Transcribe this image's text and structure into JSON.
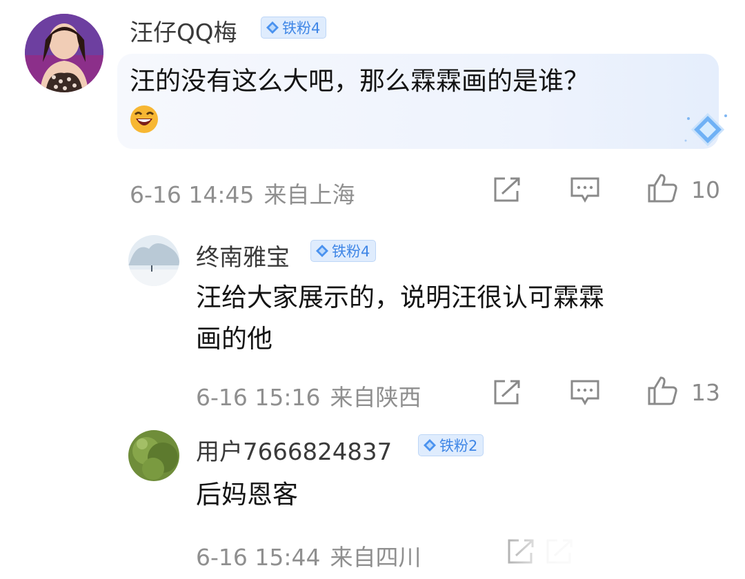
{
  "comments": [
    {
      "username": "汪仔QQ梅",
      "badge": "铁粉4",
      "text": "汪的没有这么大吧，那么霖霖画的是谁？",
      "emoji": "laughing-emoji",
      "date": "6-16 14:45",
      "location": "来自上海",
      "likes": "10"
    },
    {
      "username": "终南雅宝",
      "badge": "铁粉4",
      "text_line1": "汪给大家展示的，说明汪很认可霖霖",
      "text_line2": "画的他",
      "date": "6-16 15:16",
      "location": "来自陕西",
      "likes": "13"
    },
    {
      "username": "用户7666824837",
      "badge": "铁粉2",
      "text": "后妈恩客",
      "date": "6-16 15:44",
      "location": "来自四川"
    }
  ],
  "icons": {
    "share": "share-icon",
    "reply": "comment-icon",
    "like": "thumbs-up-icon",
    "badge": "diamond-icon"
  },
  "colors": {
    "badge_text": "#3f86e6",
    "badge_bg": "#dfecfd",
    "meta_text": "#8f8f8f",
    "bubble_bg": "#eef3fd"
  }
}
